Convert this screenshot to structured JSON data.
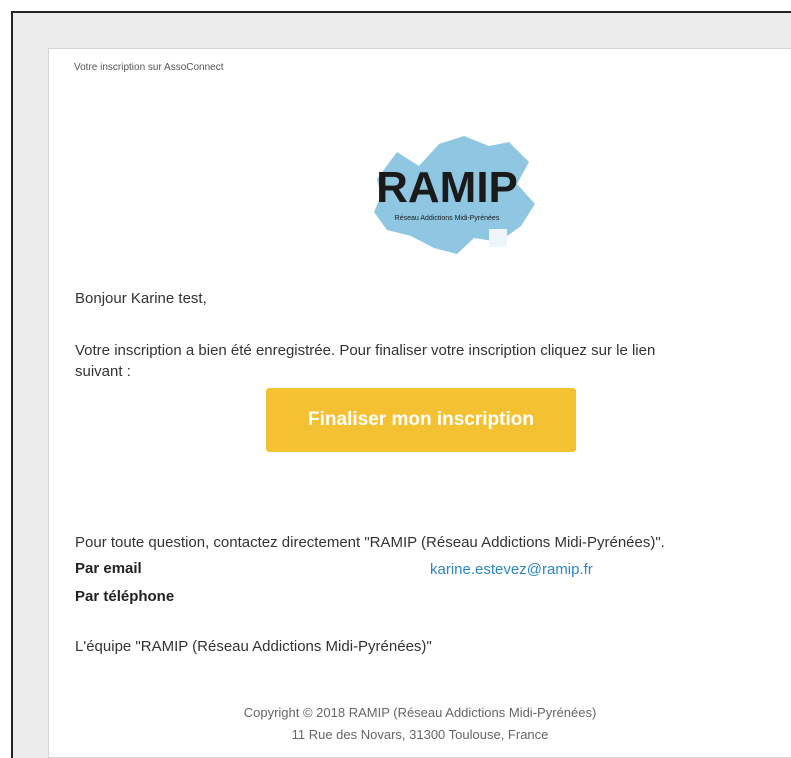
{
  "email": {
    "preheader": "Votre inscription sur AssoConnect",
    "logo_text": "RAMIP",
    "logo_subtitle": "Réseau Addictions Midi-Pyrénées",
    "greeting": "Bonjour Karine test,",
    "body_line1": "Votre inscription a bien été enregistrée. Pour finaliser votre inscription cliquez sur le lien",
    "body_line2": "suivant :",
    "cta_label": "Finaliser mon inscription",
    "contact_intro": "Pour toute question, contactez directement \"RAMIP (Réseau Addictions Midi-Pyrénées)\".",
    "email_label": "Par email",
    "email_value": "karine.estevez@ramip.fr",
    "phone_label": "Par téléphone",
    "signature": "L'équipe \"RAMIP (Réseau Addictions Midi-Pyrénées)\"",
    "copyright": "Copyright © 2018 RAMIP (Réseau Addictions Midi-Pyrénées)",
    "address": "11 Rue des Novars, 31300 Toulouse, France"
  },
  "colors": {
    "button": "#f3c132",
    "link": "#2a86c8",
    "map": "#8fc7e3"
  }
}
